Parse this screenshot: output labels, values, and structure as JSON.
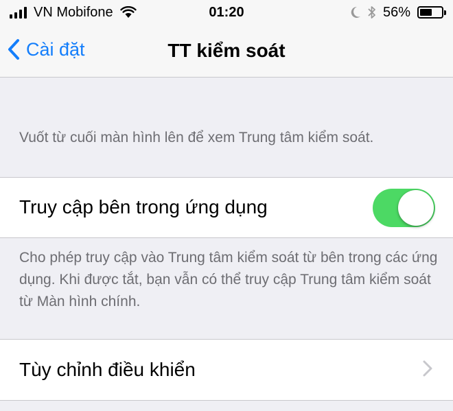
{
  "status_bar": {
    "carrier": "VN Mobifone",
    "time": "01:20",
    "battery_percent_text": "56%",
    "battery_level": 0.56,
    "signal_bars": 4,
    "icons": [
      "signal-icon",
      "wifi-icon",
      "moon-icon",
      "bluetooth-icon",
      "battery-icon"
    ]
  },
  "nav": {
    "back_label": "Cài đặt",
    "title": "TT kiểm soát",
    "back_icon": "chevron-left-icon"
  },
  "section1": {
    "footer": "Vuốt từ cuối màn hình lên để xem Trung tâm kiểm soát.",
    "row_label": "Truy cập bên trong ứng dụng",
    "toggle_on": true,
    "footer2": "Cho phép truy cập vào Trung tâm kiểm soát từ bên trong các ứng dụng. Khi được tắt, bạn vẫn có thể truy cập Trung tâm kiểm soát từ Màn hình chính."
  },
  "section2": {
    "row_label": "Tùy chỉnh điều khiển",
    "row_icon": "chevron-right-icon"
  },
  "colors": {
    "accent": "#147efb",
    "toggle_on": "#4cd964",
    "background": "#efeff4",
    "footer_text": "#6d6d72"
  }
}
